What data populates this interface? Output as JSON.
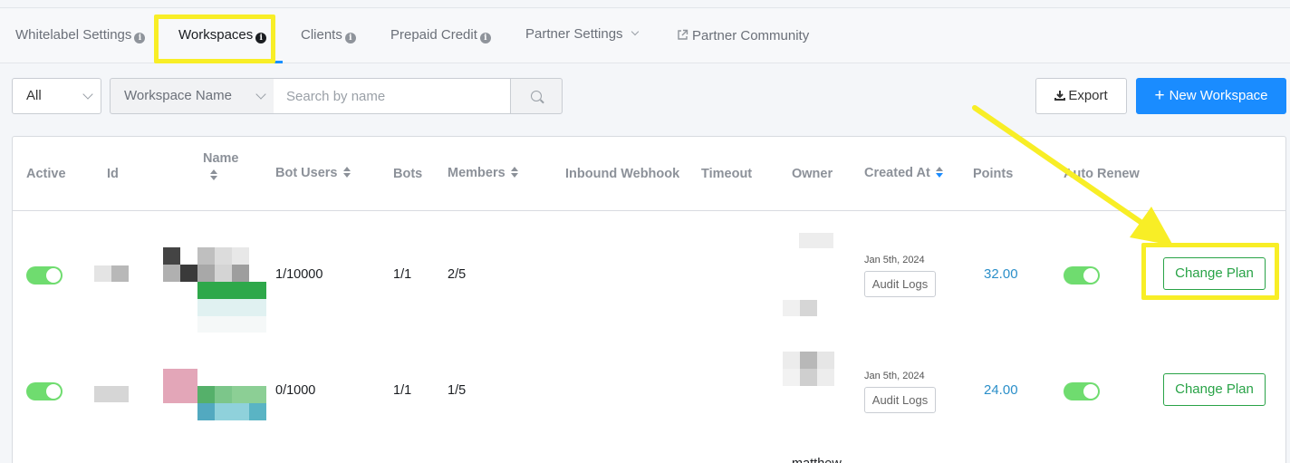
{
  "tabs": [
    {
      "label": "Whitelabel Settings",
      "info": "i"
    },
    {
      "label": "Workspaces",
      "info": "i"
    },
    {
      "label": "Clients",
      "info": "i"
    },
    {
      "label": "Prepaid Credit",
      "info": "i"
    },
    {
      "label": "Partner Settings"
    },
    {
      "label": "Partner Community"
    }
  ],
  "filters": {
    "status": "All",
    "field": "Workspace Name",
    "search_placeholder": "Search by name"
  },
  "actions": {
    "export_label": "Export",
    "new_label": "New Workspace"
  },
  "table": {
    "columns": [
      "Active",
      "Id",
      "Name",
      "Bot Users",
      "Bots",
      "Members",
      "Inbound Webhook",
      "Timeout",
      "Owner",
      "Created At",
      "Points",
      "Auto Renew"
    ],
    "rows": [
      {
        "bot_users": "1/10000",
        "bots": "1/1",
        "members": "2/5",
        "created_at": "Jan 5th, 2024",
        "audit": "Audit Logs",
        "points": "32.00",
        "action": "Change Plan"
      },
      {
        "bot_users": "0/1000",
        "bots": "1/1",
        "members": "1/5",
        "created_at": "Jan 5th, 2024",
        "audit": "Audit Logs",
        "points": "24.00",
        "action": "Change Plan"
      }
    ],
    "partial_row_owner": "matthew"
  },
  "colors": {
    "accent": "#1a8cff",
    "toggle_on": "#6fdc6f",
    "change_plan": "#29a347",
    "highlight": "#f8ee26",
    "points": "#2b8fc9"
  }
}
